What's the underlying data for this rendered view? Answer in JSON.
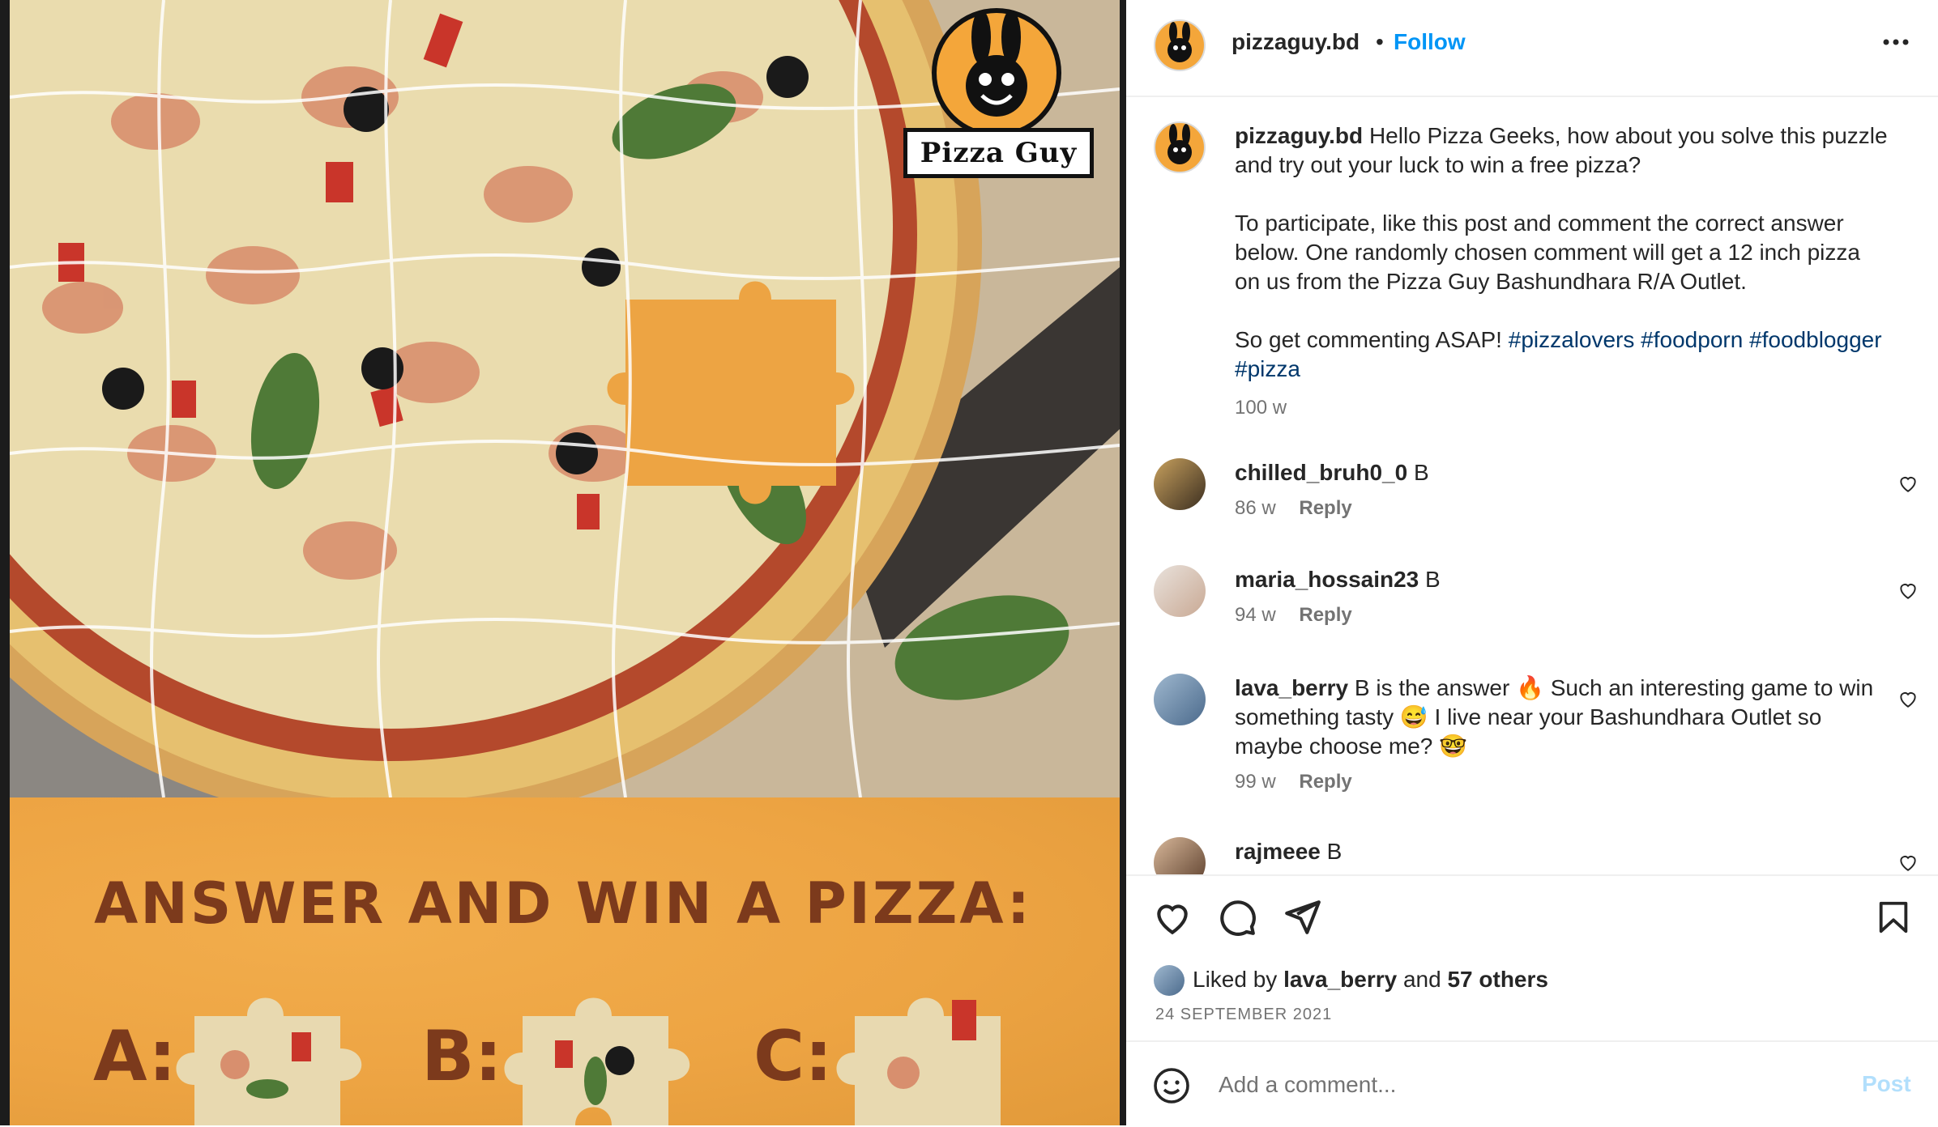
{
  "media": {
    "brand_logo_text": "Pizza Guy",
    "banner_title": "ANSWER AND WIN A PIZZA:",
    "options": [
      "A:",
      "B:",
      "C:"
    ]
  },
  "post": {
    "username": "pizzaguy.bd",
    "separator": "•",
    "follow_label": "Follow",
    "more_icon": "more-horizontal-icon",
    "caption": {
      "username": "pizzaguy.bd",
      "line1": "Hello Pizza Geeks, how about you solve this puzzle and try out your luck to win a free pizza?",
      "line2": "To participate, like this post and comment the correct answer below. One randomly chosen comment will get a 12 inch pizza on us from the Pizza Guy Bashundhara R/A Outlet.",
      "line3": "So get commenting ASAP!",
      "hashtags": [
        "#pizzalovers",
        "#foodporn",
        "#foodblogger",
        "#pizza"
      ],
      "age": "100 w"
    },
    "comments": [
      {
        "username": "chilled_bruh0_0",
        "text": "B",
        "age": "86 w",
        "reply": "Reply"
      },
      {
        "username": "maria_hossain23",
        "text": "B",
        "age": "94 w",
        "reply": "Reply"
      },
      {
        "username": "lava_berry",
        "text": "B is the answer 🔥 Such an interesting game to win something tasty 😅 I live near your Bashundhara Outlet so maybe choose me? 🤓",
        "age": "99 w",
        "reply": "Reply"
      },
      {
        "username": "rajmeee",
        "text": "B"
      }
    ],
    "likes": {
      "prefix": "Liked by",
      "user": "lava_berry",
      "middle": "and",
      "others": "57 others"
    },
    "date": "24 SEPTEMBER 2021",
    "add_comment_placeholder": "Add a comment...",
    "post_label": "Post",
    "colors": {
      "link_blue": "#0095f6",
      "hashtag_blue": "#00376b",
      "muted": "#737373",
      "banner_orange": "#eda443",
      "banner_text": "#7c3a1c"
    }
  }
}
